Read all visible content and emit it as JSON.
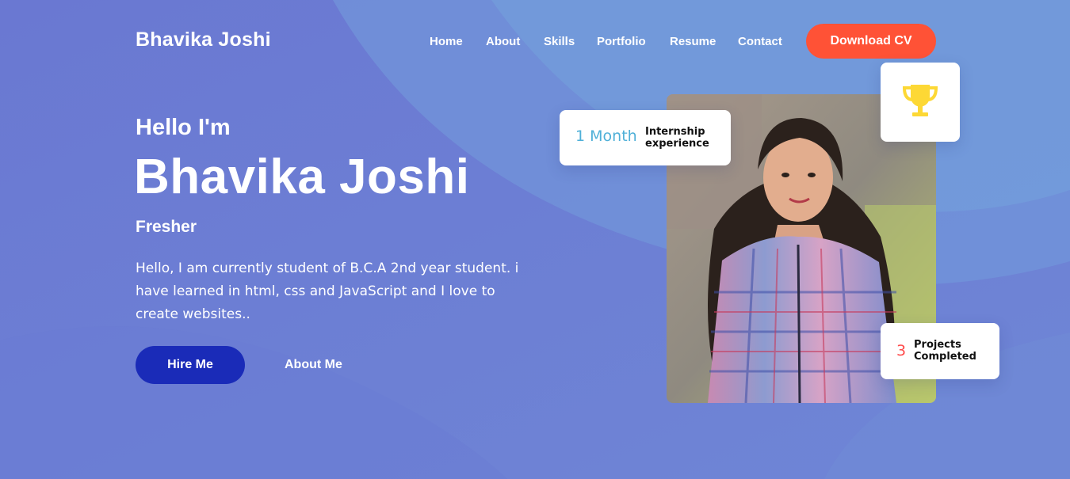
{
  "brand": {
    "name": "Bhavika Joshi"
  },
  "nav": {
    "items": [
      {
        "label": "Home"
      },
      {
        "label": "About"
      },
      {
        "label": "Skills"
      },
      {
        "label": "Portfolio"
      },
      {
        "label": "Resume"
      },
      {
        "label": "Contact"
      }
    ],
    "cta_label": "Download CV"
  },
  "hero": {
    "greeting": "Hello I'm",
    "name": "Bhavika Joshi",
    "role": "Fresher",
    "description": "Hello, I am currently student of B.C.A 2nd year student. i have learned in html, css and JavaScript and I love to create websites..",
    "hire_label": "Hire Me",
    "about_label": "About Me"
  },
  "stats": {
    "internship": {
      "value": "1 Month",
      "label": "Internship experience"
    },
    "projects": {
      "value": "3",
      "label": "Projects Completed"
    },
    "award_icon": "trophy-icon"
  },
  "colors": {
    "background": "#6b7fd4",
    "accent_cta": "#ff5236",
    "hire_button": "#1a2bb8",
    "trophy": "#fdd835",
    "internship_value": "#4fb0d8",
    "projects_value": "#ff4b4b"
  }
}
